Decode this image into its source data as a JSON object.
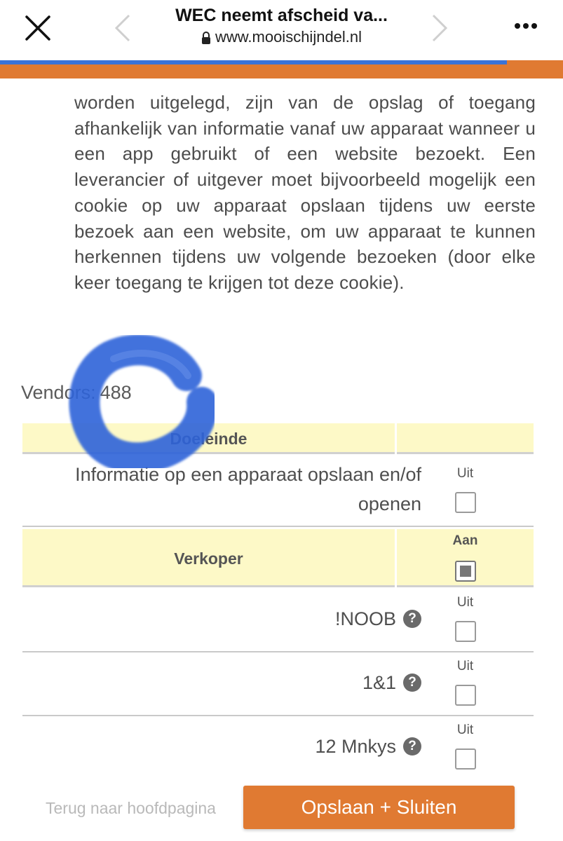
{
  "browser": {
    "title": "WEC neemt afscheid va...",
    "url": "www.mooischijndel.nl",
    "progress": 0.9
  },
  "intro_text": "worden uitgelegd, zijn van de opslag of toegang afhankelijk van informatie vanaf uw apparaat wanneer u een app gebruikt of een website bezoekt. Een leverancier of uitgever moet bijvoorbeeld mogelijk een cookie op uw apparaat opslaan tijdens uw eerste bezoek aan een website, om uw apparaat te kunnen herkennen tijdens uw volgende bezoeken (door elke keer toegang te krijgen tot deze cookie).",
  "vendors": {
    "label": "Vendors:",
    "count": "488"
  },
  "table": {
    "purpose_header": "Doeleinde",
    "purpose_row": {
      "label": "Informatie op een apparaat opslaan en/of openen",
      "status": "Uit",
      "checked": false
    },
    "vendor_header": "Verkoper",
    "vendor_all": {
      "status": "Aan",
      "checked": true
    },
    "vendors": [
      {
        "name": "!NOOB",
        "status": "Uit",
        "checked": false
      },
      {
        "name": "1&1",
        "status": "Uit",
        "checked": false
      },
      {
        "name": "12 Mnkys",
        "status": "Uit",
        "checked": false
      }
    ]
  },
  "footer": {
    "back_label": "Terug naar hoofdpagina",
    "save_label": "Opslaan + Sluiten"
  },
  "colors": {
    "accent": "#e07a32",
    "progress_blue": "#3b73d8",
    "header_bg": "#fdf9c7"
  }
}
